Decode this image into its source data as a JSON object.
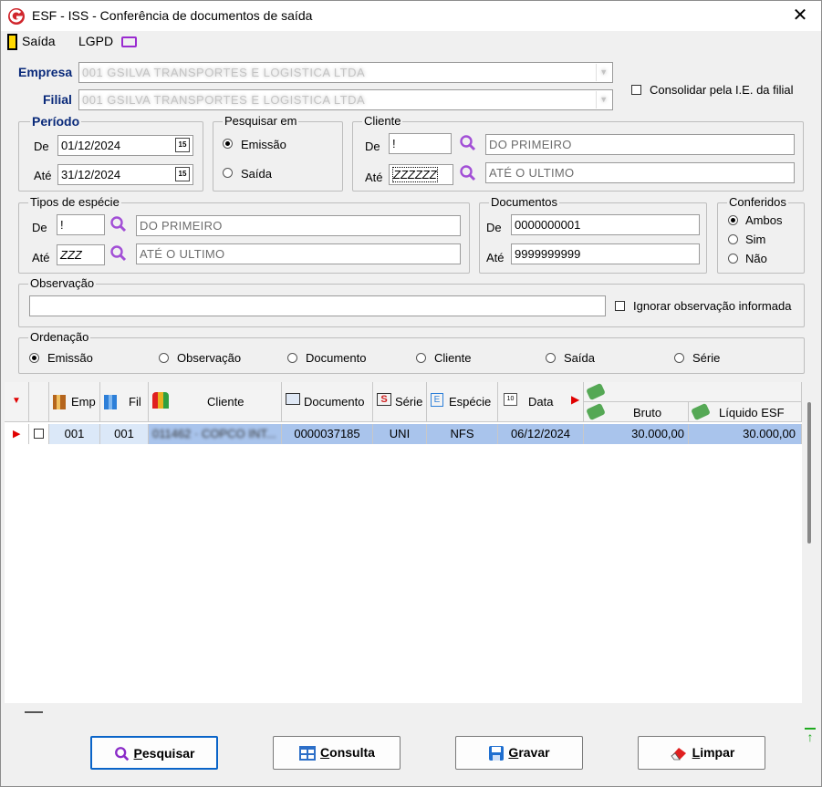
{
  "window": {
    "title": "ESF - ISS - Conferência de documentos de saída"
  },
  "menu": {
    "saida": "Saída",
    "lgpd": "LGPD"
  },
  "empresa": {
    "label": "Empresa",
    "value": "001 GSILVA TRANSPORTES E LOGISTICA LTDA"
  },
  "filial": {
    "label": "Filial",
    "value": "001 GSILVA TRANSPORTES E LOGISTICA LTDA"
  },
  "consolidar": {
    "label": "Consolidar pela I.E. da filial"
  },
  "periodo": {
    "legend": "Período",
    "de_label": "De",
    "de_value": "01/12/2024",
    "ate_label": "Até",
    "ate_value": "31/12/2024",
    "cal_icon": "15"
  },
  "pesquisar_em": {
    "legend": "Pesquisar em",
    "options": [
      "Emissão",
      "Saída"
    ]
  },
  "cliente": {
    "legend": "Cliente",
    "de_label": "De",
    "de_code": "!",
    "de_desc": "DO PRIMEIRO",
    "ate_label": "Até",
    "ate_code": "ZZZZZZ",
    "ate_desc": "ATÉ O ULTIMO"
  },
  "tipos": {
    "legend": "Tipos de espécie",
    "de_label": "De",
    "de_code": "!",
    "de_desc": "DO PRIMEIRO",
    "ate_label": "Até",
    "ate_code": "ZZZ",
    "ate_desc": "ATÉ O ULTIMO"
  },
  "documentos": {
    "legend": "Documentos",
    "de_label": "De",
    "de_value": "0000000001",
    "ate_label": "Até",
    "ate_value": "9999999999"
  },
  "conferidos": {
    "legend": "Conferidos",
    "options": [
      "Ambos",
      "Sim",
      "Não"
    ]
  },
  "observacao": {
    "legend": "Observação",
    "value": "",
    "ignorar": "Ignorar observação informada"
  },
  "ordenacao": {
    "legend": "Ordenação",
    "options": [
      "Emissão",
      "Observação",
      "Documento",
      "Cliente",
      "Saída",
      "Série"
    ]
  },
  "grid": {
    "headers": {
      "emp": "Emp",
      "fil": "Fil",
      "cliente": "Cliente",
      "documento": "Documento",
      "serie": "Série",
      "especie": "Espécie",
      "data": "Data",
      "bruto": "Bruto",
      "liquido": "Líquido ESF"
    },
    "rows": [
      {
        "emp": "001",
        "fil": "001",
        "cliente": "011462 · COPCO INT...",
        "documento": "0000037185",
        "serie": "UNI",
        "especie": "NFS",
        "data": "06/12/2024",
        "bruto": "30.000,00",
        "liquido": "30.000,00"
      }
    ]
  },
  "buttons": {
    "pesquisar": {
      "ul": "P",
      "rest": "esquisar"
    },
    "consulta": {
      "ul": "C",
      "rest": "onsulta"
    },
    "gravar": {
      "ul": "G",
      "rest": "ravar"
    },
    "limpar": {
      "ul": "L",
      "rest": "impar"
    }
  }
}
